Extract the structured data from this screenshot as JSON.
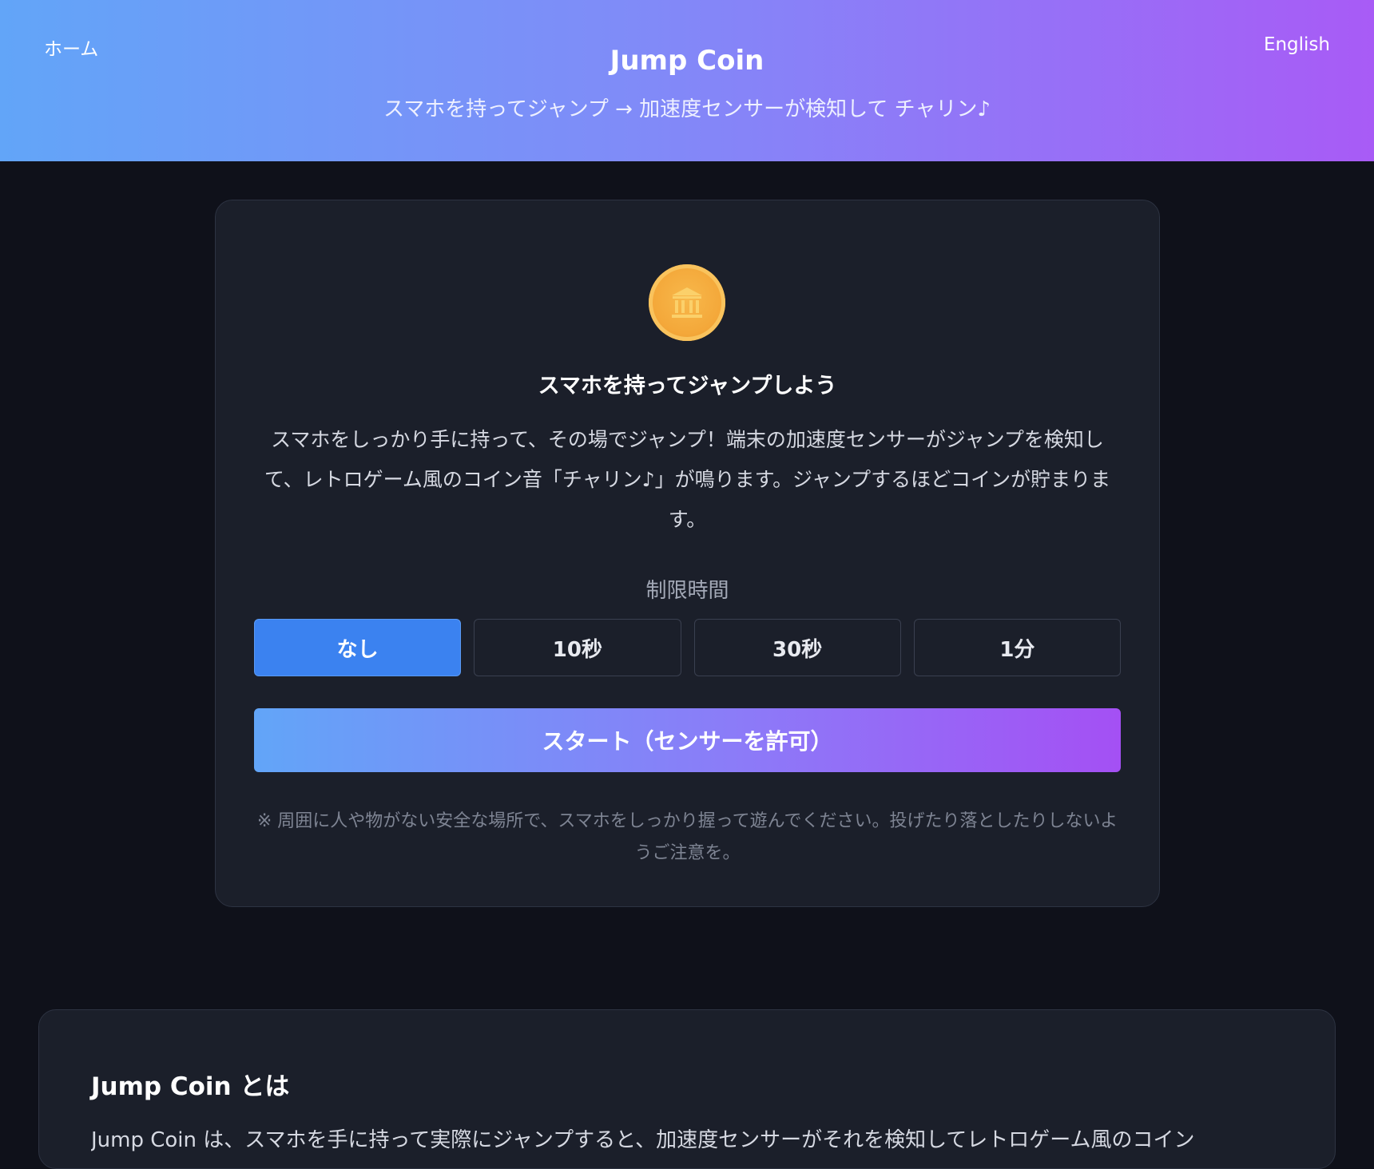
{
  "header": {
    "home_label": "ホーム",
    "title": "Jump Coin",
    "subtitle": "スマホを持ってジャンプ → 加速度センサーが検知して チャリン♪",
    "language_label": "English",
    "gradient_colors": [
      "#62a5f8",
      "#a85bf6"
    ]
  },
  "card": {
    "icon": "bank-coin-icon",
    "heading": "スマホを持ってジャンプしよう",
    "description": "スマホをしっかり手に持って、その場でジャンプ！端末の加速度センサーがジャンプを検知して、レトロゲーム風のコイン音「チャリン♪」が鳴ります。ジャンプするほどコインが貯まります。",
    "time_limit": {
      "label": "制限時間",
      "options": [
        "なし",
        "10秒",
        "30秒",
        "1分"
      ],
      "selected": "なし"
    },
    "start_button": "スタート（センサーを許可）",
    "note": "※ 周囲に人や物がない安全な場所で、スマホをしっかり握って遊んでください。投げたり落としたりしないようご注意を。"
  },
  "about": {
    "title": "Jump Coin とは",
    "text": "Jump Coin は、スマホを手に持って実際にジャンプすると、加速度センサーがそれを検知してレトロゲーム風のコイン"
  },
  "colors": {
    "background": "#0f111a",
    "card": "#1b1f2a",
    "accent": "#3b82f0",
    "coin": "#f4a83a"
  }
}
